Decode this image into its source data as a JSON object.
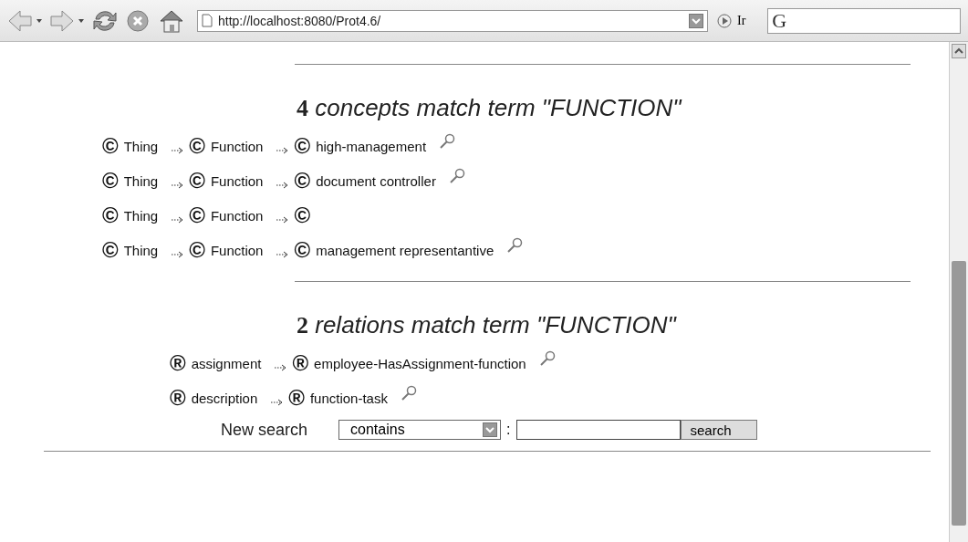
{
  "toolbar": {
    "url": "http://localhost:8080/Prot4.6/",
    "go_label": "Ir",
    "engine_label": "G"
  },
  "concepts": {
    "count": "4",
    "title": "concepts match term \"FUNCTION\"",
    "rows": [
      {
        "nodes": [
          {
            "badge": "©",
            "label": "Thing"
          },
          {
            "badge": "©",
            "label": "Function"
          },
          {
            "badge": "©",
            "label": "high-management"
          }
        ],
        "lens": true
      },
      {
        "nodes": [
          {
            "badge": "©",
            "label": "Thing"
          },
          {
            "badge": "©",
            "label": "Function"
          },
          {
            "badge": "©",
            "label": "document controller"
          }
        ],
        "lens": true
      },
      {
        "nodes": [
          {
            "badge": "©",
            "label": "Thing"
          },
          {
            "badge": "©",
            "label": "Function"
          },
          {
            "badge": "©"
          }
        ],
        "lens": false
      },
      {
        "nodes": [
          {
            "badge": "©",
            "label": "Thing"
          },
          {
            "badge": "©",
            "label": "Function"
          },
          {
            "badge": "©",
            "label": "management representantive"
          }
        ],
        "lens": true
      }
    ]
  },
  "relations": {
    "count": "2",
    "title": "relations match term \"FUNCTION\"",
    "rows": [
      {
        "nodes": [
          {
            "badge": "®",
            "label": "assignment"
          },
          {
            "badge": "®",
            "label": "employee-HasAssignment-function"
          }
        ],
        "lens": true
      },
      {
        "nodes": [
          {
            "badge": "®",
            "label": "description"
          },
          {
            "badge": "®",
            "label": "function-task"
          }
        ],
        "lens": true
      }
    ]
  },
  "search": {
    "label": "New search",
    "mode": "contains",
    "separator": ":",
    "button": "search"
  }
}
